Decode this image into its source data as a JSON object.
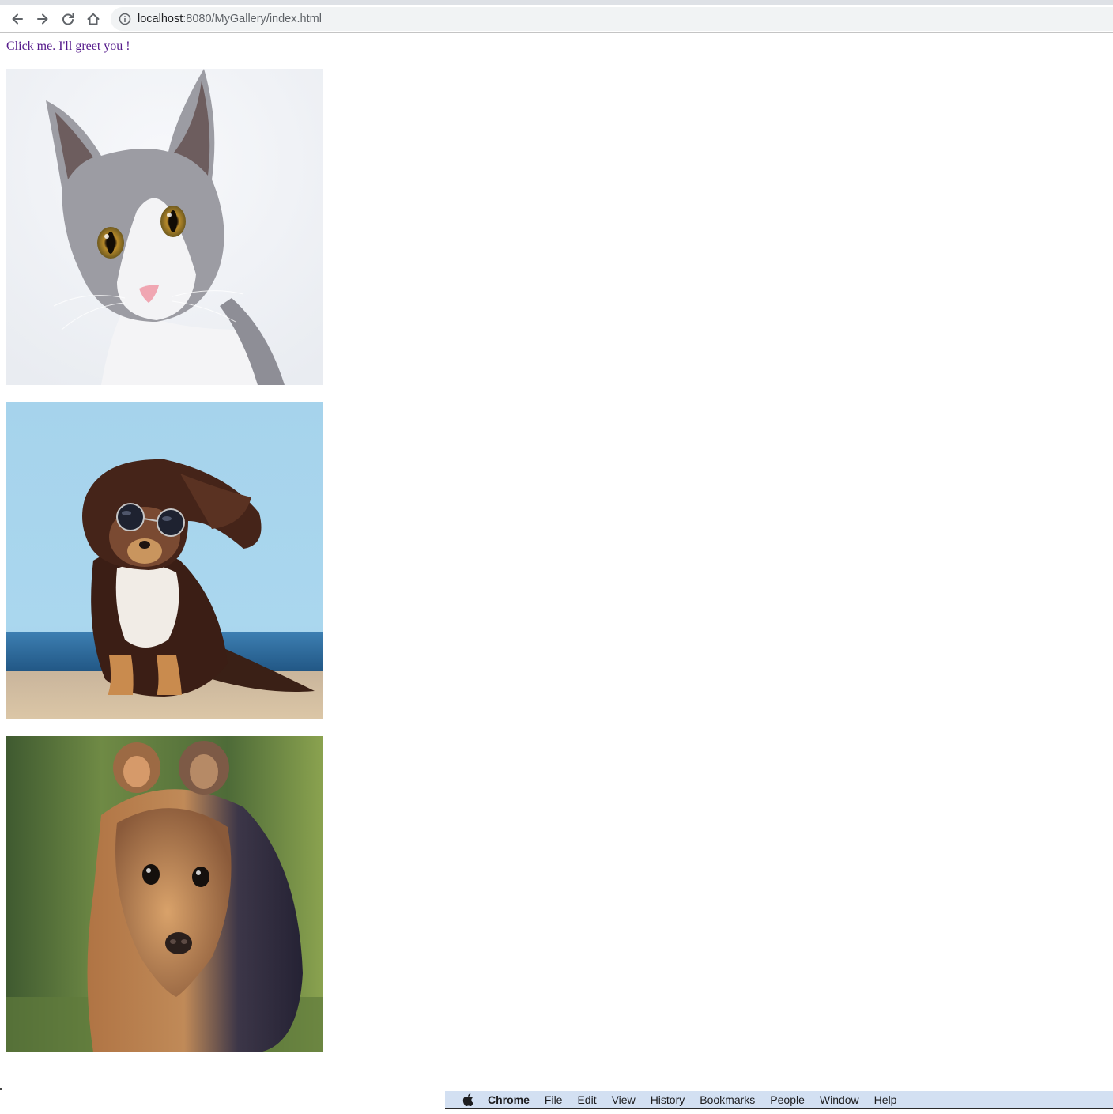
{
  "browser": {
    "url_host": "localhost",
    "url_rest": ":8080/MyGallery/index.html",
    "icons": [
      "back-arrow-icon",
      "forward-arrow-icon",
      "reload-icon",
      "home-icon",
      "info-icon"
    ]
  },
  "page": {
    "greet_link": "Click me. I'll greet you !",
    "link_color": "#551a8b"
  },
  "gallery": [
    {
      "subject": "grey-and-white-cat-photo"
    },
    {
      "subject": "dog-with-sunglasses-photo"
    },
    {
      "subject": "quokka-photo"
    }
  ],
  "menubar": {
    "app": "Chrome",
    "items": [
      "File",
      "Edit",
      "View",
      "History",
      "Bookmarks",
      "People",
      "Window",
      "Help"
    ],
    "background": "#d3e0f2"
  }
}
